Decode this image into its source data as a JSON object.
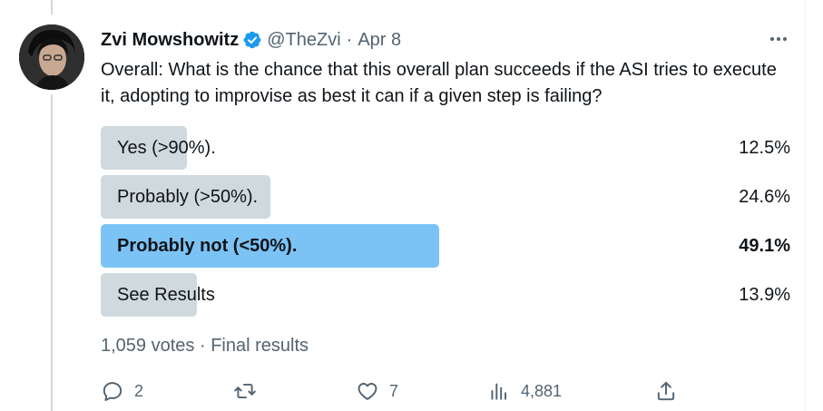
{
  "author": {
    "name": "Zvi Mowshowitz",
    "handle": "@TheZvi",
    "separator": "·",
    "date": "Apr 8",
    "verified_color": "#1d9bf0"
  },
  "tweet": {
    "text": "Overall: What is the chance that this overall plan succeeds if the ASI tries to execute it, adopting to improvise as best it can if a given step is failing?"
  },
  "poll": {
    "options": [
      {
        "label": "Yes (>90%).",
        "percent_text": "12.5%",
        "percent": 12.5,
        "winner": false
      },
      {
        "label": "Probably (>50%).",
        "percent_text": "24.6%",
        "percent": 24.6,
        "winner": false
      },
      {
        "label": "Probably not (<50%).",
        "percent_text": "49.1%",
        "percent": 49.1,
        "winner": true
      },
      {
        "label": "See Results",
        "percent_text": "13.9%",
        "percent": 13.9,
        "winner": false
      }
    ],
    "votes": "1,059 votes",
    "meta_separator": "·",
    "status": "Final results",
    "bar_color": "#cfd9de",
    "winner_color": "#7cc3f5"
  },
  "actions": {
    "replies": {
      "icon": "reply-icon",
      "count": "2"
    },
    "retweets": {
      "icon": "retweet-icon",
      "count": ""
    },
    "likes": {
      "icon": "like-icon",
      "count": "7"
    },
    "views": {
      "icon": "views-icon",
      "count": "4,881"
    },
    "share": {
      "icon": "share-icon"
    }
  }
}
